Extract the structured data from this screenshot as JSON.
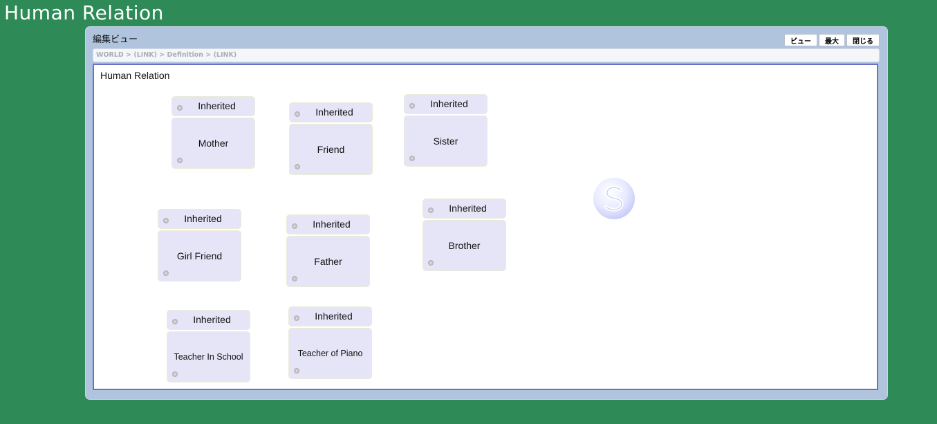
{
  "page": {
    "title": "Human Relation"
  },
  "window": {
    "title": "編集ビュー",
    "buttons": {
      "view": "ビュー",
      "maximize": "最大",
      "close": "閉じる"
    },
    "breadcrumb": "WORLD > (LINK) > Definition > (LINK)"
  },
  "canvas": {
    "title": "Human Relation",
    "nodes": [
      {
        "head": "Inherited",
        "label": "Mother"
      },
      {
        "head": "Inherited",
        "label": "Friend"
      },
      {
        "head": "Inherited",
        "label": "Sister"
      },
      {
        "head": "Inherited",
        "label": "Girl Friend"
      },
      {
        "head": "Inherited",
        "label": "Father"
      },
      {
        "head": "Inherited",
        "label": "Brother"
      },
      {
        "head": "Inherited",
        "label": "Teacher In School"
      },
      {
        "head": "Inherited",
        "label": "Teacher of Piano"
      }
    ],
    "watermark_icon": "s-logo-icon"
  },
  "colors": {
    "background": "#2e8b57",
    "window": "#b0c4de",
    "canvas_border": "#6a70c8",
    "node_fill": "#e5e5f7"
  }
}
